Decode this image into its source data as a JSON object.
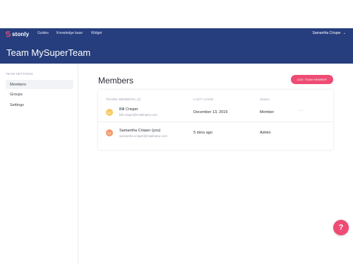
{
  "brand": {
    "name": "stonly"
  },
  "nav": {
    "links": [
      "Guides",
      "Knowledge base",
      "Widget"
    ],
    "user_name": "Samantha Crisper",
    "user_chevron": "⌄"
  },
  "header": {
    "title": "Team MySuperTeam"
  },
  "sidebar": {
    "heading": "TEAM SETTINGS",
    "items": [
      {
        "label": "Members",
        "active": true
      },
      {
        "label": "Groups",
        "active": false
      },
      {
        "label": "Settings",
        "active": false
      }
    ]
  },
  "main": {
    "title": "Members",
    "add_button": "ADD TEAM MEMBER"
  },
  "table": {
    "columns": [
      "TEAMS MEMBERS (2)",
      "LAST LOGIN",
      "Status"
    ],
    "rows": [
      {
        "initials": "BC",
        "name": "Bill Crisper",
        "email": "bill.crisper@mailinator.com",
        "last_login": "December 13, 2019",
        "status": "Member",
        "more": "···",
        "avatar_color": "#f7c95e"
      },
      {
        "initials": "SC",
        "name": "Samantha Crisper (you)",
        "email": "samantha.crisper@mailinator.com",
        "last_login": "5 mins ago",
        "status": "Admin",
        "avatar_color": "#f39a6b"
      }
    ]
  },
  "help": {
    "label": "?"
  },
  "colors": {
    "header_bg": "#263e7d",
    "accent": "#ee4c74"
  }
}
